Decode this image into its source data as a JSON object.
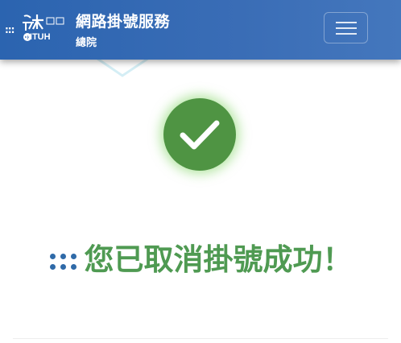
{
  "header": {
    "logo_text": "NTUH",
    "logo_chars": "台大醫院",
    "title": "網路掛號服務",
    "subtitle": "總院",
    "menu_icon": "hamburger-icon"
  },
  "status": {
    "icon": "checkmark-icon",
    "message": "您已取消掛號成功！"
  },
  "colors": {
    "header_blue": "#3a6db6",
    "success_green": "#4f9443",
    "message_green": "#4f9a52",
    "dots_blue": "#2f6aa8"
  }
}
